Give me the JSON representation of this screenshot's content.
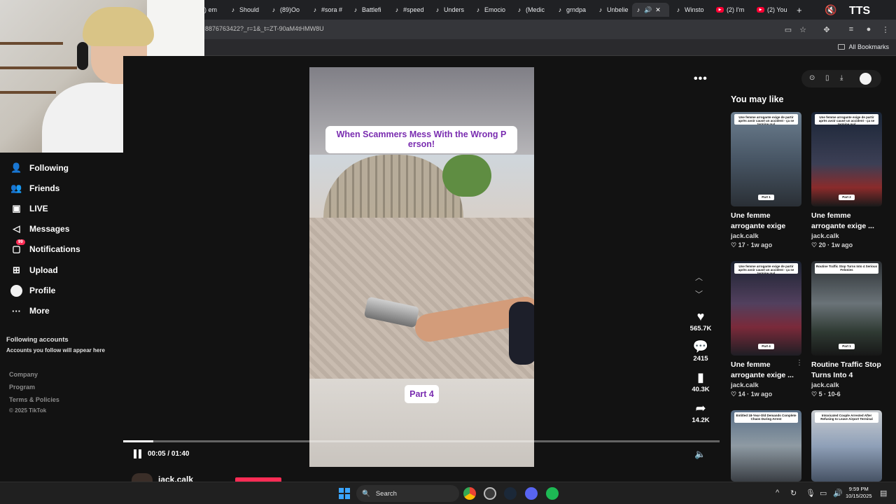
{
  "browser": {
    "tabs": [
      {
        "label": ") em",
        "icon": "tiktok-icon",
        "active": false
      },
      {
        "label": "Should",
        "icon": "tiktok-icon",
        "active": false
      },
      {
        "label": "(89)Oo",
        "icon": "tiktok-icon",
        "active": false
      },
      {
        "label": "#sora #",
        "icon": "tiktok-icon",
        "active": false
      },
      {
        "label": "Battlefi",
        "icon": "tiktok-icon",
        "active": false
      },
      {
        "label": "#speed",
        "icon": "tiktok-icon",
        "active": false
      },
      {
        "label": "Unders",
        "icon": "tiktok-icon",
        "active": false
      },
      {
        "label": "Emocio",
        "icon": "tiktok-icon",
        "active": false
      },
      {
        "label": "(Medic",
        "icon": "tiktok-icon",
        "active": false
      },
      {
        "label": "grndpa",
        "icon": "tiktok-icon",
        "active": false
      },
      {
        "label": "Unbelie",
        "icon": "tiktok-icon",
        "active": false
      },
      {
        "label": "",
        "icon": "tiktok-icon",
        "active": true
      },
      {
        "label": "Winsto",
        "icon": "tiktok-icon",
        "active": false
      },
      {
        "label": "(2) I'm",
        "icon": "youtube-icon",
        "active": false
      },
      {
        "label": "(2) You",
        "icon": "youtube-icon",
        "active": false
      }
    ],
    "url": "8876763422?_r=1&_t=ZT-90aM4tHMW8U",
    "bookmarks_label": "All Bookmarks",
    "overlay_logo": "TTS"
  },
  "sidebar": {
    "items": [
      {
        "label": "Following",
        "icon": "following-icon"
      },
      {
        "label": "Friends",
        "icon": "friends-icon"
      },
      {
        "label": "LIVE",
        "icon": "live-icon"
      },
      {
        "label": "Messages",
        "icon": "messages-icon"
      },
      {
        "label": "Notifications",
        "icon": "notifications-icon",
        "badge": "99"
      },
      {
        "label": "Upload",
        "icon": "upload-icon"
      },
      {
        "label": "Profile",
        "icon": "profile-icon"
      },
      {
        "label": "More",
        "icon": "more-icon"
      }
    ],
    "following_title": "Following accounts",
    "following_sub": "Accounts you follow will appear here",
    "footer": [
      "Company",
      "Program",
      "Terms & Policies",
      "© 2025 TikTok"
    ]
  },
  "video": {
    "caption": "When Scammers Mess With the Wrong P erson!",
    "part_label": "Part 4",
    "time": "00:05 / 01:40",
    "progress_fraction": 0.05,
    "creator": "jack.calk",
    "actions": [
      {
        "name": "like",
        "icon": "heart-icon",
        "count": "565.7K"
      },
      {
        "name": "comment",
        "icon": "comment-icon",
        "count": "2415"
      },
      {
        "name": "save",
        "icon": "bookmark-icon",
        "count": "40.3K"
      },
      {
        "name": "share",
        "icon": "share-icon",
        "count": "14.2K"
      }
    ]
  },
  "recommended": {
    "title": "You may like",
    "cards": [
      {
        "title": "Une femme arrogante exige de...",
        "author": "jack.calk",
        "likes": "17",
        "age": "1w ago",
        "thumb_banner": "Une femme arrogante exige de partir après avoir causé un accident - ça se termine mal",
        "thumb_label": "Part 1"
      },
      {
        "title": "Une femme arrogante exige ...",
        "author": "jack.calk",
        "likes": "20",
        "age": "1w ago",
        "thumb_banner": "Une femme arrogante exige de partir après avoir causé un accident - ça se termine mal",
        "thumb_label": "Part 2"
      },
      {
        "title": "Une femme arrogante exige ...",
        "author": "jack.calk",
        "likes": "14",
        "age": "1w ago",
        "thumb_banner": "Une femme arrogante exige de partir après avoir causé un accident - ça se termine mal",
        "thumb_label": "Part 4"
      },
      {
        "title": "Routine Traffic Stop Turns Into 4 Seriou...",
        "author": "jack.calk",
        "likes": "5",
        "age": "10-6",
        "thumb_banner": "Routine Traffic Stop Turns Into 4 Serious Felonies",
        "thumb_label": "Part 1"
      },
      {
        "title": "",
        "author": "",
        "likes": "",
        "age": "",
        "thumb_banner": "Entitled 18-Year-Old Demands Complete Chaos During Arrest",
        "thumb_label": ""
      },
      {
        "title": "",
        "author": "",
        "likes": "",
        "age": "",
        "thumb_banner": "Intoxicated Couple Arrested After Refusing to Leave Airport Terminal",
        "thumb_label": ""
      }
    ]
  },
  "taskbar": {
    "search_label": "Search",
    "time": "9:59 PM",
    "date": "10/15/2025"
  },
  "colors": {
    "accent": "#fe2c55",
    "caption_text": "#7a2db0",
    "background": "#121212"
  }
}
